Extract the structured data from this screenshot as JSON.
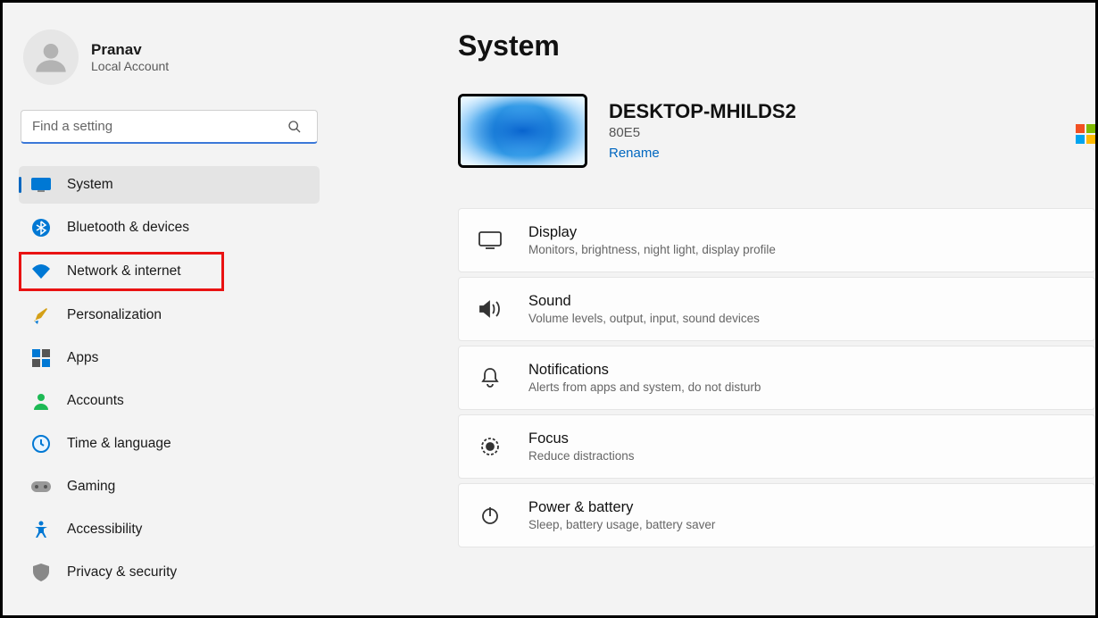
{
  "profile": {
    "name": "Pranav",
    "subtitle": "Local Account"
  },
  "search": {
    "placeholder": "Find a setting"
  },
  "nav": {
    "system": "System",
    "bluetooth": "Bluetooth & devices",
    "network": "Network & internet",
    "personalization": "Personalization",
    "apps": "Apps",
    "accounts": "Accounts",
    "time": "Time & language",
    "gaming": "Gaming",
    "accessibility": "Accessibility",
    "privacy": "Privacy & security"
  },
  "main": {
    "title": "System",
    "device_name": "DESKTOP-MHILDS2",
    "device_model": "80E5",
    "rename": "Rename"
  },
  "cards": {
    "display": {
      "title": "Display",
      "sub": "Monitors, brightness, night light, display profile"
    },
    "sound": {
      "title": "Sound",
      "sub": "Volume levels, output, input, sound devices"
    },
    "notifications": {
      "title": "Notifications",
      "sub": "Alerts from apps and system, do not disturb"
    },
    "focus": {
      "title": "Focus",
      "sub": "Reduce distractions"
    },
    "power": {
      "title": "Power & battery",
      "sub": "Sleep, battery usage, battery saver"
    }
  }
}
